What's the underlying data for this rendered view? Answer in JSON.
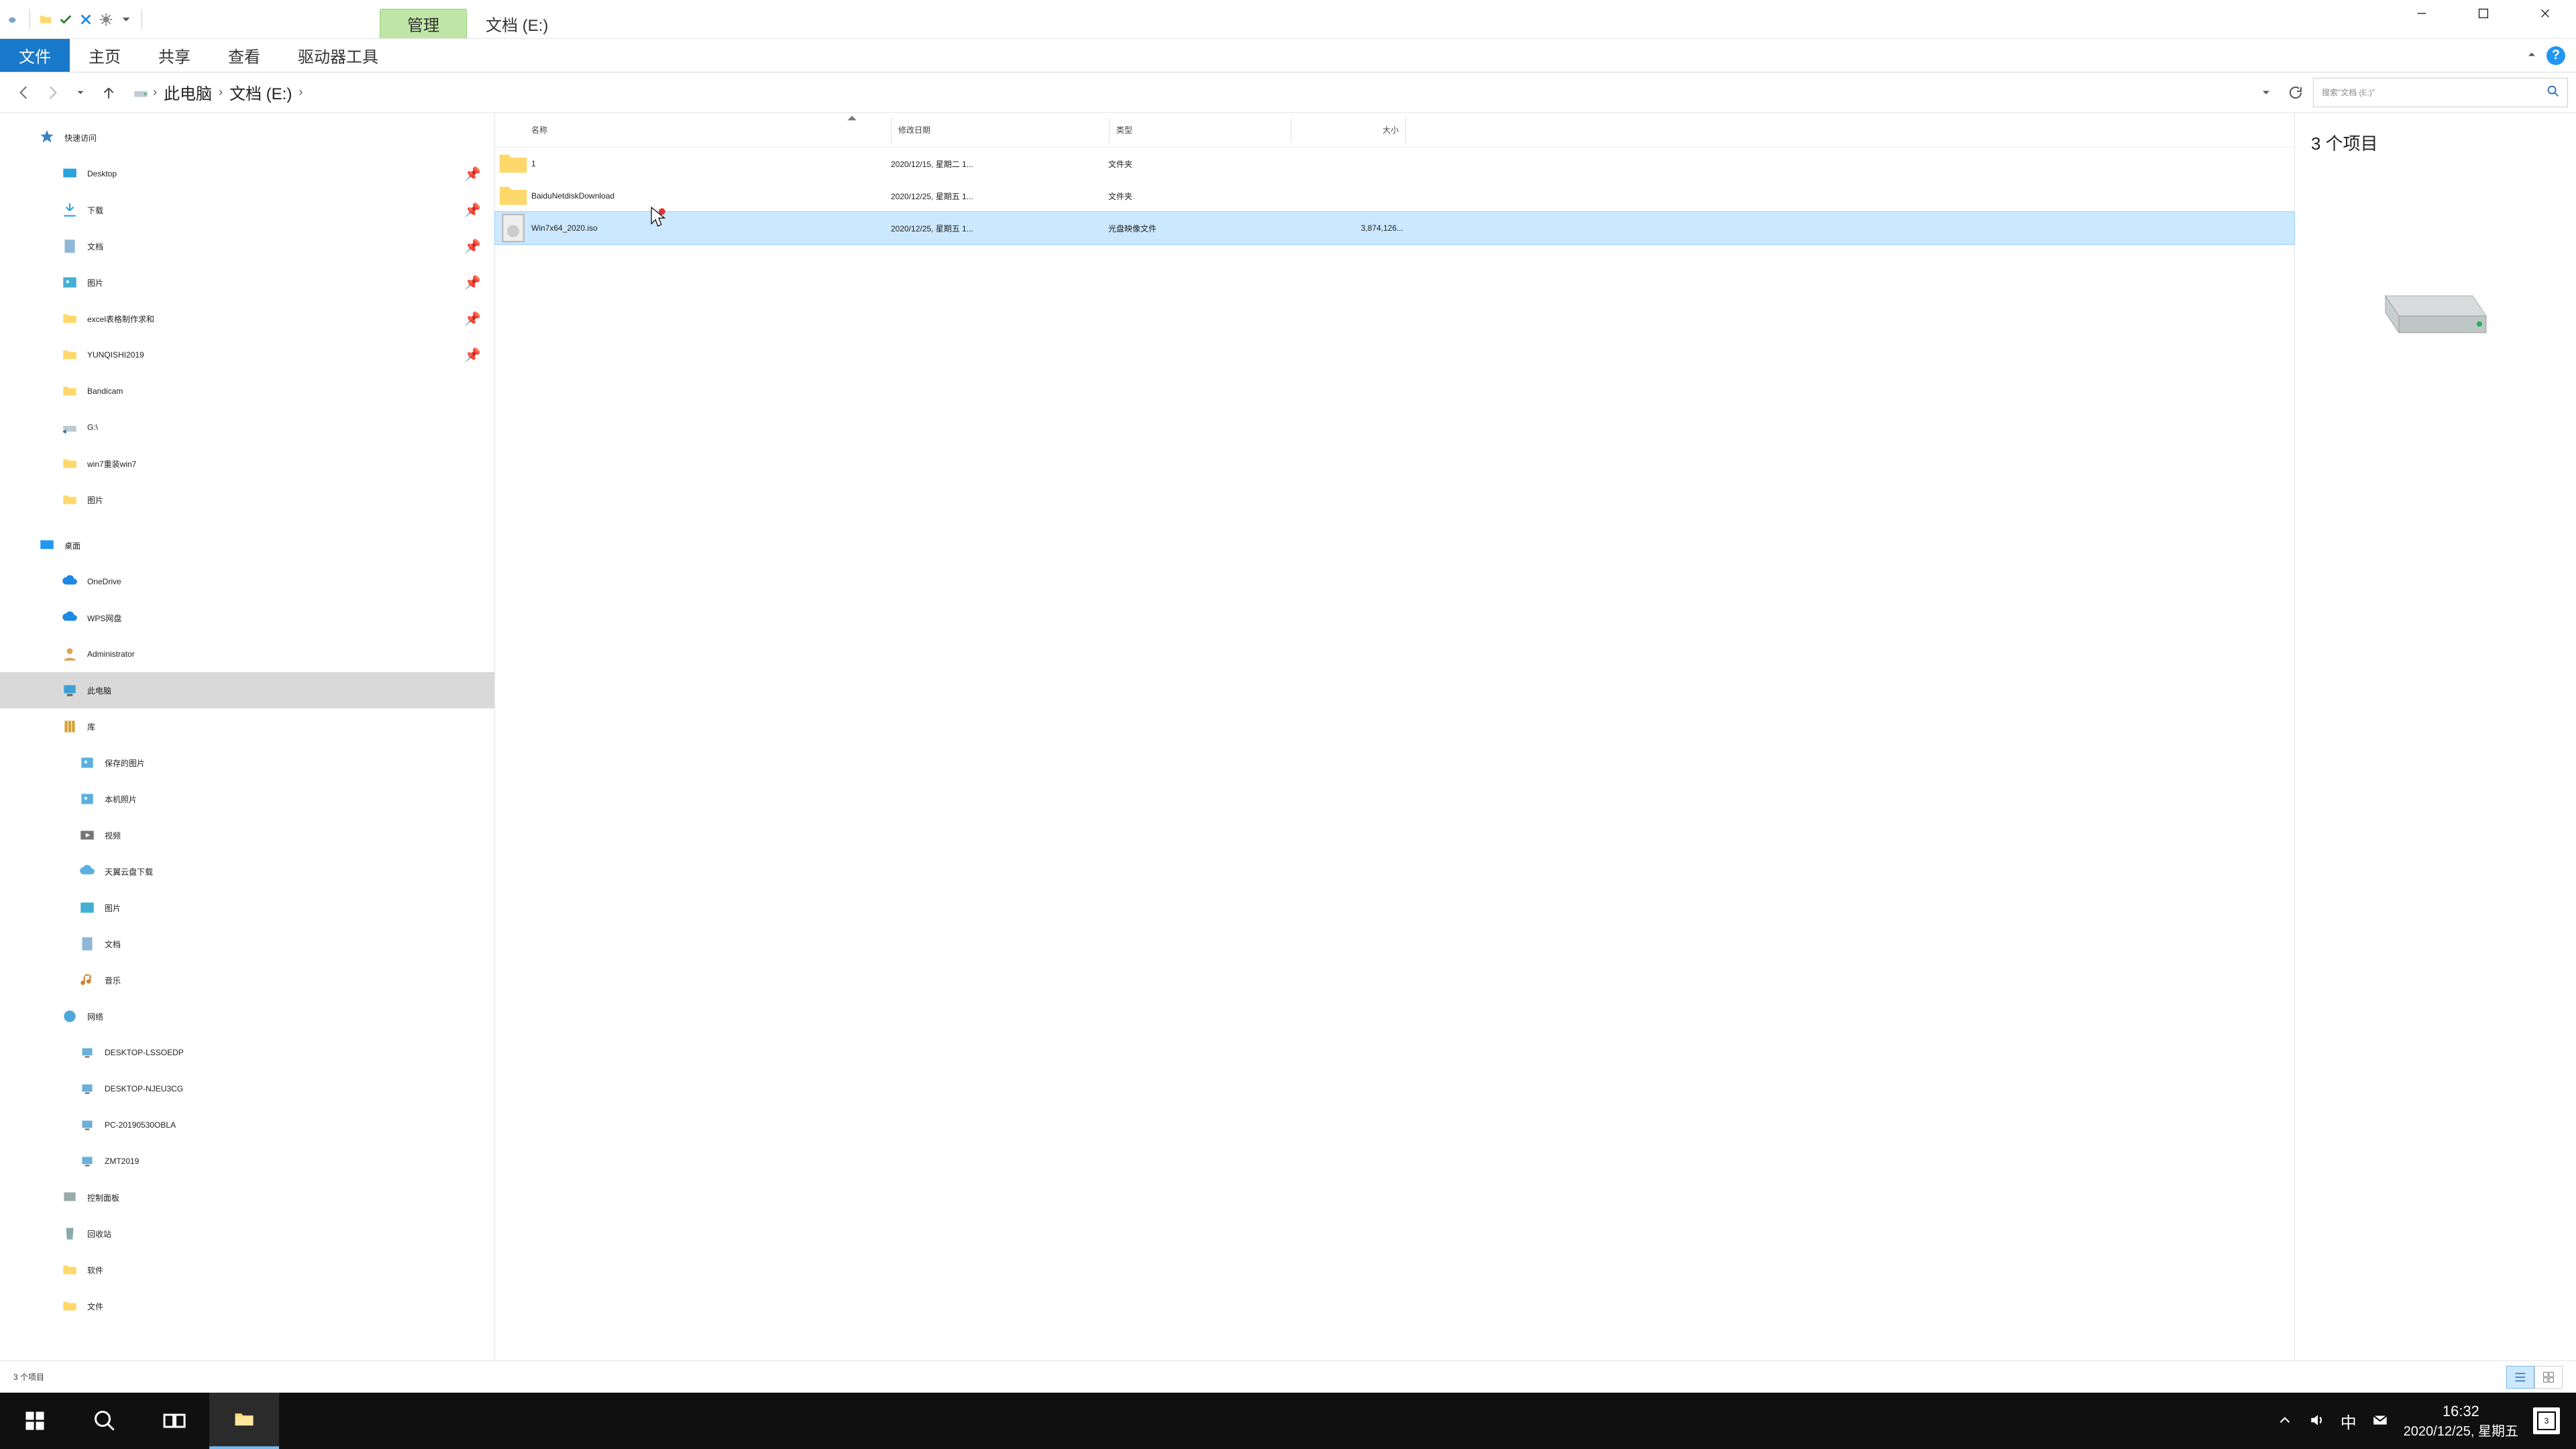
{
  "titlebar": {
    "context_tab": "管理",
    "title": "文档 (E:)"
  },
  "ribbon": {
    "file": "文件",
    "tabs": [
      "主页",
      "共享",
      "查看",
      "驱动器工具"
    ]
  },
  "address": {
    "crumbs": [
      "此电脑",
      "文档 (E:)"
    ]
  },
  "search": {
    "placeholder": "搜索\"文档 (E:)\""
  },
  "nav": {
    "quick_access": "快速访问",
    "qa_items": [
      {
        "label": "Desktop",
        "icon": "desktop"
      },
      {
        "label": "下载",
        "icon": "download"
      },
      {
        "label": "文档",
        "icon": "doc"
      },
      {
        "label": "图片",
        "icon": "pic"
      },
      {
        "label": "excel表格制作求和",
        "icon": "folder"
      },
      {
        "label": "YUNQISHI2019",
        "icon": "folder"
      },
      {
        "label": "Bandicam",
        "icon": "folder"
      },
      {
        "label": "G:\\",
        "icon": "drive-link"
      },
      {
        "label": "win7重装win7",
        "icon": "folder"
      },
      {
        "label": "图片",
        "icon": "folder"
      }
    ],
    "desktop": "桌面",
    "desk_items": [
      {
        "label": "OneDrive",
        "icon": "cloud"
      },
      {
        "label": "WPS网盘",
        "icon": "cloud2"
      },
      {
        "label": "Administrator",
        "icon": "user"
      },
      {
        "label": "此电脑",
        "icon": "pc",
        "selected": true
      },
      {
        "label": "库",
        "icon": "lib"
      }
    ],
    "lib_items": [
      {
        "label": "保存的图片",
        "icon": "picfile"
      },
      {
        "label": "本机照片",
        "icon": "picfile"
      },
      {
        "label": "视频",
        "icon": "video"
      },
      {
        "label": "天翼云盘下载",
        "icon": "cloud3"
      },
      {
        "label": "图片",
        "icon": "picture"
      },
      {
        "label": "文档",
        "icon": "doc"
      },
      {
        "label": "音乐",
        "icon": "music"
      }
    ],
    "network": "网络",
    "net_items": [
      {
        "label": "DESKTOP-LSSOEDP"
      },
      {
        "label": "DESKTOP-NJEU3CG"
      },
      {
        "label": "PC-20190530OBLA"
      },
      {
        "label": "ZMT2019"
      }
    ],
    "control_panel": "控制面板",
    "recycle": "回收站",
    "software": "软件",
    "wenjian": "文件"
  },
  "files": {
    "headers": {
      "name": "名称",
      "date": "修改日期",
      "type": "类型",
      "size": "大小"
    },
    "rows": [
      {
        "name": "1",
        "date": "2020/12/15, 星期二 1...",
        "type": "文件夹",
        "size": "",
        "icon": "folder"
      },
      {
        "name": "BaiduNetdiskDownload",
        "date": "2020/12/25, 星期五 1...",
        "type": "文件夹",
        "size": "",
        "icon": "folder"
      },
      {
        "name": "Win7x64_2020.iso",
        "date": "2020/12/25, 星期五 1...",
        "type": "光盘映像文件",
        "size": "3,874,126...",
        "icon": "iso",
        "selected": true
      }
    ]
  },
  "preview": {
    "title": "3 个项目"
  },
  "status": "3 个项目",
  "taskbar": {
    "time": "16:32",
    "date": "2020/12/25, 星期五",
    "ime": "中",
    "notif_count": "3"
  }
}
